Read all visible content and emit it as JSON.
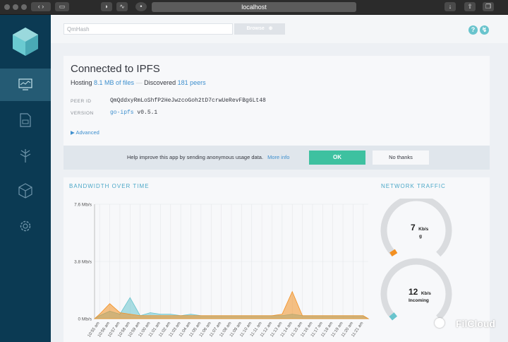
{
  "browser": {
    "url": "localhost"
  },
  "sidebar": {
    "items": [
      "status",
      "files",
      "explore",
      "peers",
      "settings"
    ]
  },
  "search": {
    "placeholder": "QmHash",
    "browse_label": "Browse"
  },
  "status": {
    "title": "Connected to IPFS",
    "hosting_prefix": "Hosting",
    "hosting_value": "8.1 MB of files",
    "separator": "—",
    "discovered_prefix": "Discovered",
    "peers_value": "181 peers",
    "peer_id_label": "PEER ID",
    "peer_id": "QmQddxyRmLoShfP2HeJwzcoGoh2tD7crwUeRevFBg6Lt48",
    "version_label": "VERSION",
    "version_name": "go-ipfs",
    "version_number": "v0.5.1",
    "advanced_label": "▶ Advanced"
  },
  "consent": {
    "text": "Help improve this app by sending anonymous usage data.",
    "more_info": "More info",
    "ok_label": "OK",
    "no_label": "No thanks"
  },
  "bandwidth": {
    "title": "BANDWIDTH OVER TIME",
    "colors": {
      "in": "#69c4cd",
      "out": "#f39021"
    }
  },
  "traffic": {
    "title": "NETWORK TRAFFIC",
    "out_value": "7",
    "out_unit": "Kb/s",
    "out_label": "g",
    "in_value": "12",
    "in_unit": "Kb/s",
    "in_label": "Incoming"
  },
  "chart_data": {
    "type": "area",
    "title": "BANDWIDTH OVER TIME",
    "ylim": [
      0,
      7.6
    ],
    "y_ticks": [
      "7.6 Mb/s",
      "3.8 Mb/s",
      "0 Mb/s"
    ],
    "x": [
      "10:55 am",
      "10:56 am",
      "10:57 am",
      "10:58 am",
      "10:59 am",
      "11:00 am",
      "11:01 am",
      "11:02 am",
      "11:03 am",
      "11:04 am",
      "11:05 am",
      "11:06 am",
      "11:07 am",
      "11:08 am",
      "11:09 am",
      "11:10 am",
      "11:11 am",
      "11:12 am",
      "11:13 am",
      "11:14 am",
      "11:15 am",
      "11:16 am",
      "11:17 am",
      "11:18 am",
      "11:19 am",
      "11:20 am",
      "11:21 am"
    ],
    "series": [
      {
        "name": "incoming",
        "values": [
          0.2,
          0.5,
          0.3,
          1.4,
          0.2,
          0.4,
          0.3,
          0.3,
          0.2,
          0.3,
          0.2,
          0.2,
          0.2,
          0.2,
          0.2,
          0.2,
          0.2,
          0.2,
          0.2,
          0.3,
          0.2,
          0.2,
          0.2,
          0.2,
          0.2,
          0.2,
          0.2
        ]
      },
      {
        "name": "outgoing",
        "values": [
          0.3,
          1.0,
          0.4,
          0.3,
          0.2,
          0.2,
          0.2,
          0.2,
          0.2,
          0.2,
          0.2,
          0.2,
          0.2,
          0.2,
          0.2,
          0.2,
          0.2,
          0.2,
          0.3,
          1.8,
          0.2,
          0.2,
          0.2,
          0.2,
          0.2,
          0.2,
          0.2
        ]
      }
    ],
    "grid": true
  },
  "watermark": "FilCloud"
}
